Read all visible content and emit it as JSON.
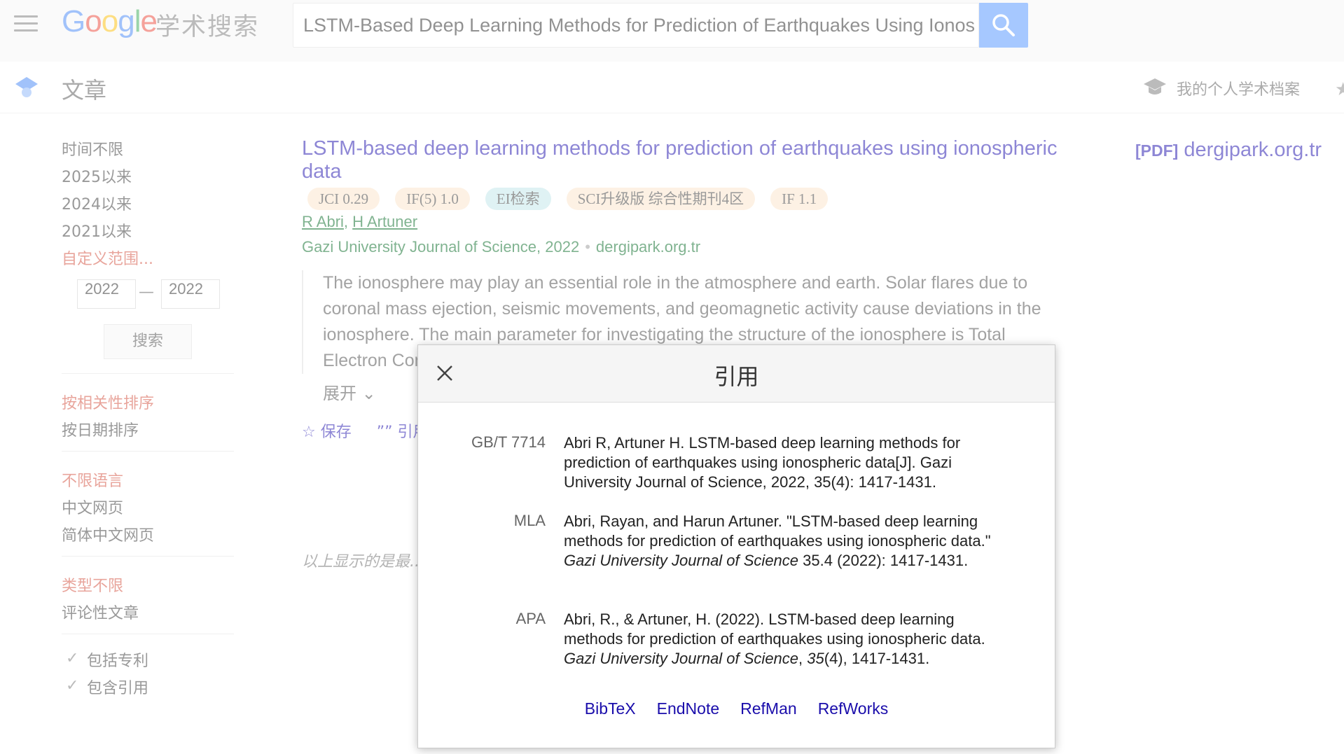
{
  "header": {
    "logo_letters": [
      "G",
      "o",
      "o",
      "g",
      "l",
      "e"
    ],
    "logo_sub": "学术搜索",
    "search_value": "LSTM-Based Deep Learning Methods for Prediction of Earthquakes Using Ionospheric Data"
  },
  "subbar": {
    "title": "文章",
    "profile_link": "我的个人学术档案"
  },
  "sidebar": {
    "time_filters": [
      "时间不限",
      "2025以来",
      "2024以来",
      "2021以来"
    ],
    "custom_range": "自定义范围...",
    "year_from": "2022",
    "year_separator": "—",
    "year_to": "2022",
    "search_button": "搜索",
    "sort_options": [
      "按相关性排序",
      "按日期排序"
    ],
    "language_options": [
      "不限语言",
      "中文网页",
      "简体中文网页"
    ],
    "type_options": [
      "类型不限",
      "评论性文章"
    ],
    "checkboxes": [
      "包括专利",
      "包含引用"
    ]
  },
  "result": {
    "title": "LSTM-based deep learning methods for prediction of earthquakes using ionospheric data",
    "badges": [
      "JCI 0.29",
      "IF(5) 1.0",
      "EI检索",
      "SCI升级版 综合性期刊4区",
      "IF 1.1"
    ],
    "author_1": "R Abri",
    "author_2": "H Artuner",
    "venue": "Gazi University Journal of Science, 2022",
    "domain": "dergipark.org.tr",
    "abstract": "The ionosphere may play an essential role in the atmosphere and earth. Solar flares due to coronal mass ejection, seismic movements, and geomagnetic activity cause deviations in the ionosphere. The main parameter for investigating the structure of the ionosphere is Total Electron Content ... technique fo... article analy...",
    "expand": "展开",
    "save": "保存",
    "cite": "引用",
    "pdf_tag": "[PDF]",
    "pdf_domain": "dergipark.org.tr"
  },
  "footer_note": "以上显示的是最...",
  "modal": {
    "title": "引用",
    "citations": [
      {
        "style": "GB/T 7714",
        "text": "Abri R, Artuner H. LSTM-based deep learning methods for prediction of earthquakes using ionospheric data[J]. Gazi University Journal of Science, 2022, 35(4): 1417-1431."
      },
      {
        "style": "MLA",
        "pre": "Abri, Rayan, and Harun Artuner. \"LSTM-based deep learning methods for prediction of earthquakes using ionospheric data.\" ",
        "journal": "Gazi University Journal of Science",
        "post": " 35.4 (2022): 1417-1431."
      },
      {
        "style": "APA",
        "pre": "Abri, R., & Artuner, H. (2022). LSTM-based deep learning methods for prediction of earthquakes using ionospheric data. ",
        "journal": "Gazi University Journal of Science",
        "mid": ", ",
        "volume": "35",
        "post": "(4), 1417-1431."
      }
    ],
    "export_links": [
      "BibTeX",
      "EndNote",
      "RefMan",
      "RefWorks"
    ]
  },
  "colors": {
    "accent_blue": "#4d90fe",
    "link": "#1a0dab",
    "green": "#006621",
    "red_filter": "#d14836"
  }
}
